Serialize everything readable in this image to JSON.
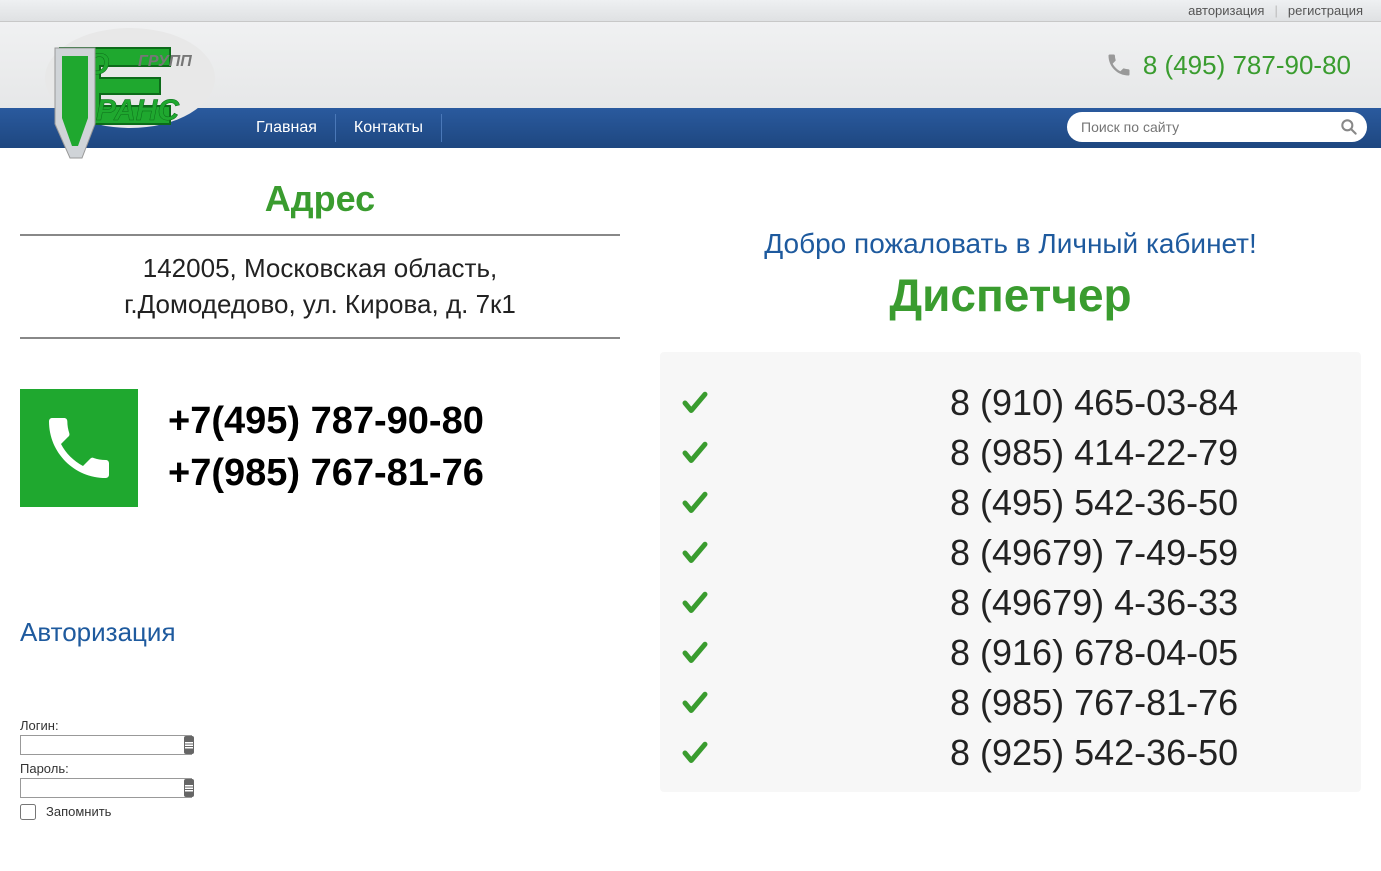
{
  "topbar": {
    "login": "авторизация",
    "register": "регистрация"
  },
  "header": {
    "phone": "8 (495) 787-90-80"
  },
  "nav": {
    "items": [
      "Главная",
      "Контакты"
    ]
  },
  "search": {
    "placeholder": "Поиск по сайту"
  },
  "address": {
    "title": "Адрес",
    "line1": "142005, Московская область,",
    "line2": "г.Домодедово, ул. Кирова, д. 7к1"
  },
  "contact_phones": {
    "p1": "+7(495) 787-90-80",
    "p2": "+7(985) 767-81-76"
  },
  "auth": {
    "title": "Авторизация",
    "login_label": "Логин:",
    "password_label": "Пароль:",
    "remember_label": "Запомнить"
  },
  "welcome": "Добро пожаловать в Личный кабинет!",
  "dispatcher_title": "Диспетчер",
  "dispatcher_phones": [
    "8 (910) 465-03-84",
    "8 (985) 414-22-79",
    "8 (495) 542-36-50",
    "8 (49679) 7-49-59",
    "8 (49679) 4-36-33",
    "8 (916) 678-04-05",
    "8 (985) 767-81-76",
    "8 (925) 542-36-50"
  ]
}
